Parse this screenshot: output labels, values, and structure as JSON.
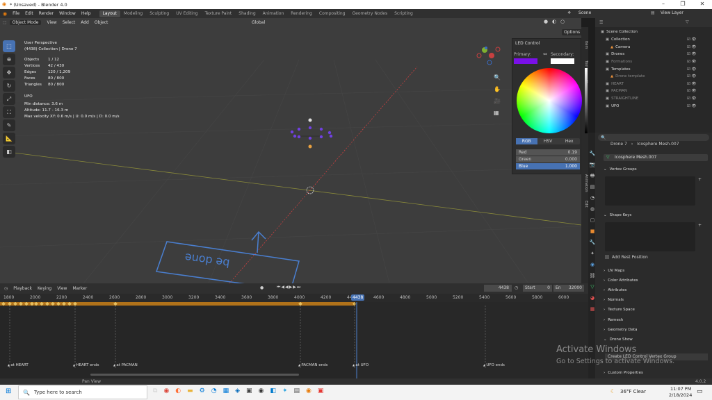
{
  "window": {
    "title": "* (Unsaved) - Blender 4.0",
    "min": "–",
    "max": "❐",
    "close": "✕"
  },
  "menu": {
    "items": [
      "File",
      "Edit",
      "Render",
      "Window",
      "Help"
    ],
    "workspaces": [
      "Layout",
      "Modeling",
      "Sculpting",
      "UV Editing",
      "Texture Paint",
      "Shading",
      "Animation",
      "Rendering",
      "Compositing",
      "Geometry Nodes",
      "Scripting"
    ],
    "active_workspace": "Layout",
    "scene": "Scene",
    "view_layer": "View Layer"
  },
  "viewport": {
    "mode": "Object Mode",
    "header_items": [
      "View",
      "Select",
      "Add",
      "Object"
    ],
    "orientation": "Global",
    "options": "Options",
    "overlay_title": "User Perspective",
    "overlay_collection": "(4438) Collection | Drone 7",
    "stats": [
      {
        "label": "Objects",
        "value": "1 / 12"
      },
      {
        "label": "Vertices",
        "value": "42 / 430"
      },
      {
        "label": "Edges",
        "value": "120 / 1,209"
      },
      {
        "label": "Faces",
        "value": "80 / 800"
      },
      {
        "label": "Triangles",
        "value": "80 / 800"
      }
    ],
    "ufo_title": "UFO",
    "ufo_lines": [
      "Min distance: 3.6 m",
      "Altitude: 11.7 - 16.3 m",
      "Max velocity XY: 0.6 m/s | U: 0.0 m/s | D: 0.0 m/s"
    ],
    "floor_text": "be done",
    "side_tabs": [
      "Item",
      "Tool",
      "View",
      "Animation",
      "Edit"
    ]
  },
  "led_panel": {
    "title": "LED Control",
    "primary": "Primary:",
    "secondary": "Secondary:",
    "primary_color": "#7a10e8",
    "modes": [
      "RGB",
      "HSV",
      "Hex"
    ],
    "active_mode": "RGB",
    "channels": [
      {
        "label": "Red",
        "value": "0.19"
      },
      {
        "label": "Green",
        "value": "0.000"
      },
      {
        "label": "Blue",
        "value": "1.000"
      }
    ]
  },
  "outliner": {
    "root": "Scene Collection",
    "items": [
      {
        "label": "Collection",
        "indent": 1,
        "color": "#ddd"
      },
      {
        "label": "Camera",
        "indent": 2,
        "color": "#ddd"
      },
      {
        "label": "Drones",
        "indent": 1,
        "color": "#ddd"
      },
      {
        "label": "Formations",
        "indent": 1,
        "color": "#888"
      },
      {
        "label": "Templates",
        "indent": 1,
        "color": "#ddd"
      },
      {
        "label": "Drone template",
        "indent": 2,
        "color": "#888"
      },
      {
        "label": "HEART",
        "indent": 1,
        "color": "#888"
      },
      {
        "label": "PACMAN",
        "indent": 1,
        "color": "#888"
      },
      {
        "label": "STRAIGHTLINE",
        "indent": 1,
        "color": "#888"
      },
      {
        "label": "UFO",
        "indent": 1,
        "color": "#ddd"
      }
    ]
  },
  "properties": {
    "breadcrumb": [
      "Drone 7",
      "Icosphere Mesh.007"
    ],
    "mesh_name": "Icosphere Mesh.007",
    "sections": [
      "Vertex Groups",
      "Shape Keys"
    ],
    "add_rest": "Add Rest Position",
    "closed_sections": [
      "UV Maps",
      "Color Attributes",
      "Attributes",
      "Normals",
      "Texture Space",
      "Remesh",
      "Geometry Data",
      "Drone Show"
    ],
    "custom": "Custom Properties",
    "drone_show_label": "Create LED Control Vertex Group"
  },
  "timeline": {
    "header_items": [
      "Playback",
      "Keying",
      "View",
      "Marker"
    ],
    "current_frame": "4438",
    "start_label": "Start",
    "start": "0",
    "end_label": "En",
    "end": "32000",
    "ruler": [
      "1800",
      "2000",
      "2200",
      "2400",
      "2600",
      "2800",
      "3000",
      "3200",
      "3400",
      "3600",
      "3800",
      "4000",
      "4200",
      "4400",
      "4600",
      "4800",
      "5000",
      "5200",
      "5400",
      "5600",
      "5800",
      "6000"
    ],
    "playhead": "4438",
    "markers": [
      "at HEART",
      "HEART ends",
      "at PACMAN",
      "PACMAN ends",
      "at UFO",
      "UFO ends"
    ]
  },
  "status": {
    "pan": "Pan View",
    "version": "4.0.2"
  },
  "watermark": {
    "line1": "Activate Windows",
    "line2": "Go to Settings to activate Windows."
  },
  "taskbar": {
    "search": "Type here to search",
    "weather": "36°F  Clear",
    "time": "11:07 PM",
    "date": "2/18/2024"
  }
}
